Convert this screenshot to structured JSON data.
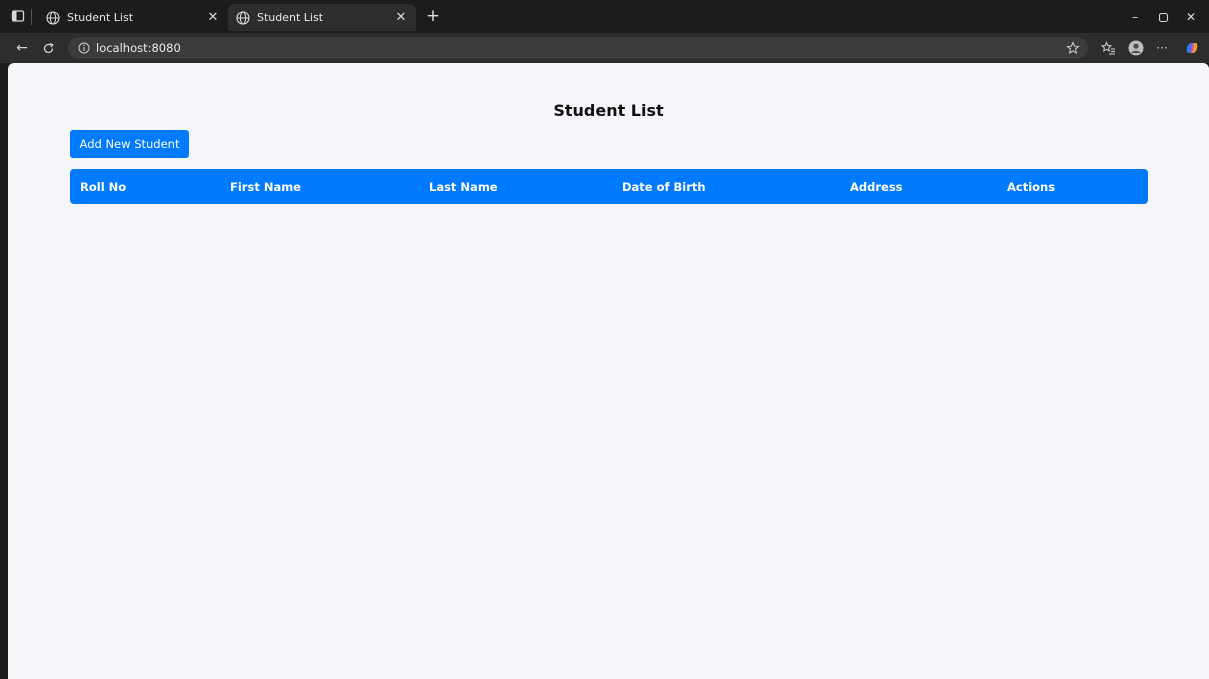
{
  "browser": {
    "tabs": [
      {
        "title": "Student List",
        "active": false
      },
      {
        "title": "Student List",
        "active": true
      }
    ],
    "address": "localhost:8080"
  },
  "page": {
    "title": "Student List",
    "add_button_label": "Add New Student",
    "table": {
      "columns": [
        "Roll No",
        "First Name",
        "Last Name",
        "Date of Birth",
        "Address",
        "Actions"
      ],
      "rows": []
    }
  },
  "colors": {
    "primary": "#007bff",
    "page_bg": "#f4f6f9",
    "chrome_bg": "#1c1c1c",
    "toolbar_bg": "#2d2d2d"
  }
}
